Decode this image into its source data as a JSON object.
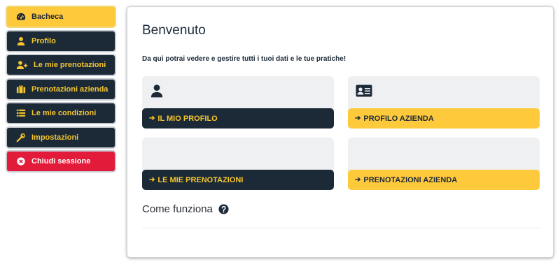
{
  "sidebar": {
    "items": [
      {
        "label": "Bacheca",
        "icon": "dashboard-gauge-icon"
      },
      {
        "label": "Profilo",
        "icon": "user-icon"
      },
      {
        "label": "Le mie prenotazioni",
        "icon": "user-plus-icon"
      },
      {
        "label": "Prenotazioni azienda",
        "icon": "briefcase-icon"
      },
      {
        "label": "Le mie condizioni",
        "icon": "list-icon"
      },
      {
        "label": "Impostazioni",
        "icon": "wrench-icon"
      },
      {
        "label": "Chiudi sessione",
        "icon": "close-circle-icon"
      }
    ]
  },
  "main": {
    "title": "Benvenuto",
    "intro": "Da qui potrai vedere e gestire tutti i tuoi dati e le tue pratiche!",
    "tiles": [
      {
        "label": "IL MIO PROFILO",
        "icon": "user-icon"
      },
      {
        "label": "PROFILO AZIENDA",
        "icon": "id-card-icon"
      },
      {
        "label": "LE MIE PRENOTAZIONI"
      },
      {
        "label": "PRENOTAZIONI AZIENDA"
      }
    ],
    "how_title": "Come funziona"
  },
  "colors": {
    "dark": "#1c2a38",
    "accent_yellow": "#ffc93c",
    "logout_red": "#e31b3a",
    "tile_bg": "#eff0f2"
  }
}
